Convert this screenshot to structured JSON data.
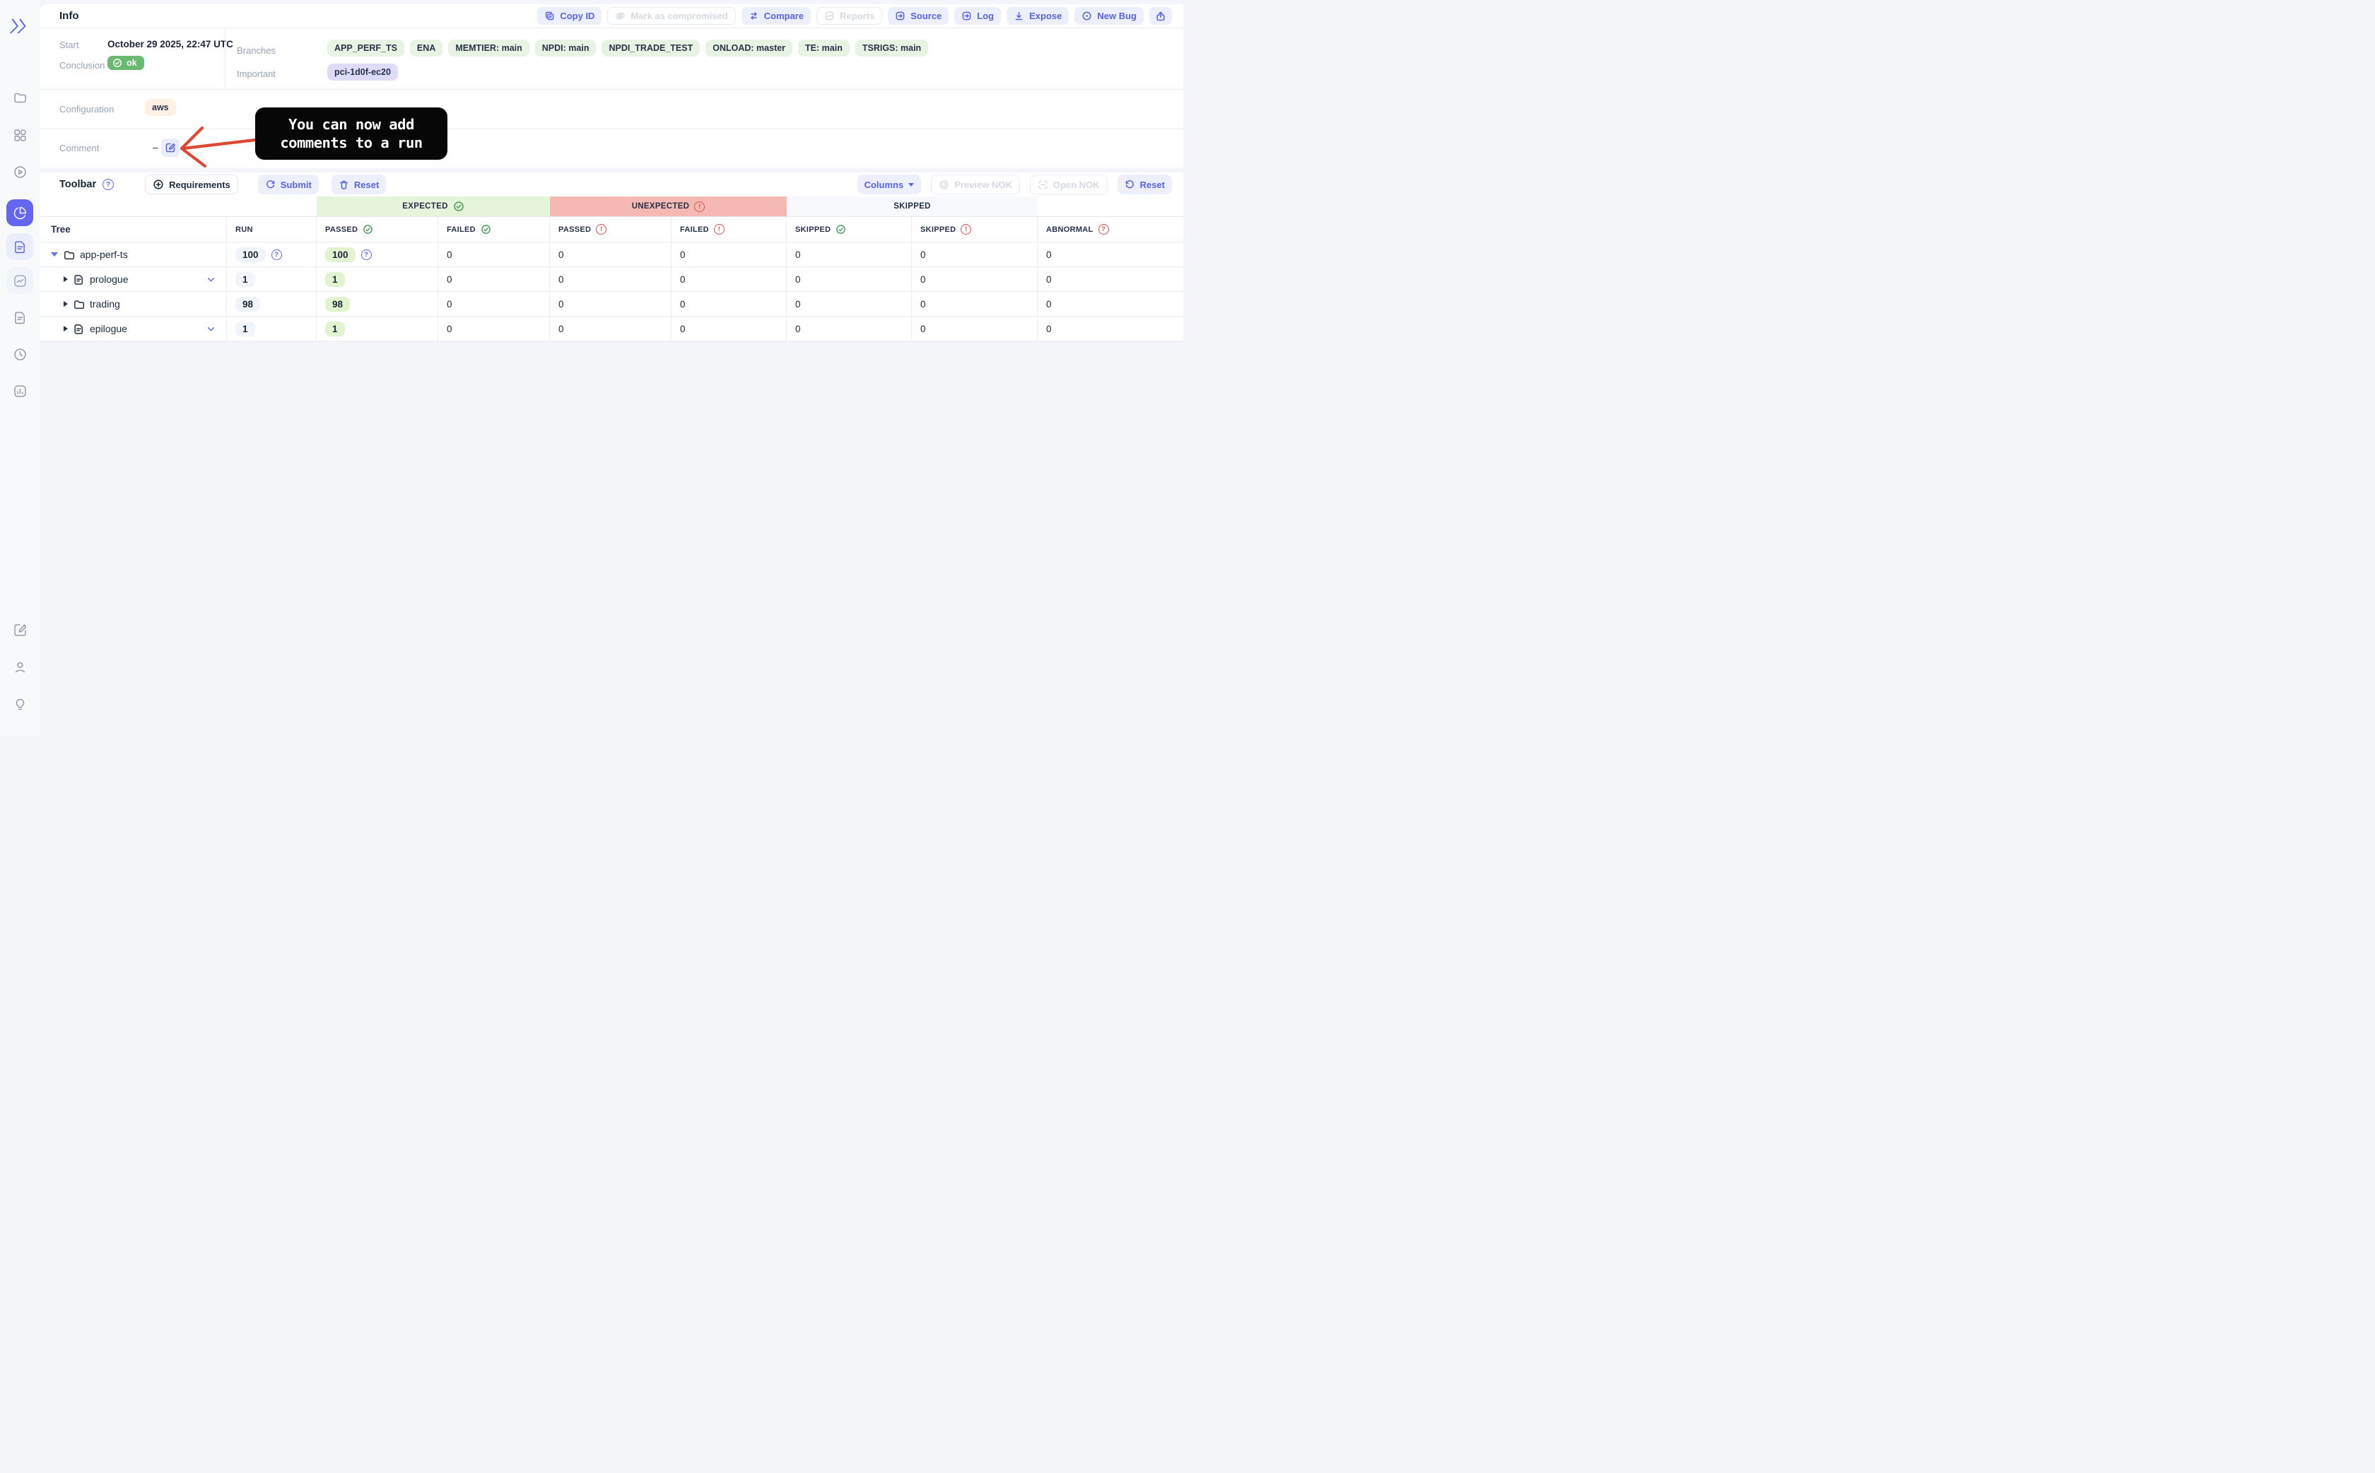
{
  "header": {
    "title": "Info",
    "actions": [
      {
        "label": "Copy ID",
        "disabled": false,
        "icon": "copy-icon"
      },
      {
        "label": "Mark as compromised",
        "disabled": true,
        "icon": "eye-off-icon"
      },
      {
        "label": "Compare",
        "disabled": false,
        "icon": "compare-arrows-icon"
      },
      {
        "label": "Reports",
        "disabled": true,
        "icon": "report-chart-icon"
      },
      {
        "label": "Source",
        "disabled": false,
        "icon": "arrow-box-icon"
      },
      {
        "label": "Log",
        "disabled": false,
        "icon": "arrow-box-icon"
      },
      {
        "label": "Expose",
        "disabled": false,
        "icon": "download-icon"
      },
      {
        "label": "New Bug",
        "disabled": false,
        "icon": "circle-dot-icon"
      }
    ],
    "share_icon": "share-icon"
  },
  "info": {
    "start_label": "Start",
    "start_value": "October 29 2025, 22:47 UTC",
    "conclusion_label": "Conclusion",
    "conclusion_value": "ok",
    "branches_label": "Branches",
    "branches": [
      "APP_PERF_TS",
      "ENA",
      "MEMTIER: main",
      "NPDI: main",
      "NPDI_TRADE_TEST",
      "ONLOAD: master",
      "TE: main",
      "TSRIGS: main"
    ],
    "important_label": "Important",
    "important_value": "pci-1d0f-ec20",
    "configuration_label": "Configuration",
    "configuration_value": "aws",
    "comment_label": "Comment",
    "comment_value": "–"
  },
  "annotation": {
    "line1": "You can now add",
    "line2": "comments to a run",
    "arrow_color": "#dd4733"
  },
  "toolbar": {
    "title": "Toolbar",
    "requirements_label": "Requirements",
    "submit_label": "Submit",
    "reset_label": "Reset",
    "columns_label": "Columns",
    "preview_nok_label": "Preview NOK",
    "open_nok_label": "Open NOK",
    "reset_right_label": "Reset"
  },
  "table": {
    "tree_header": "Tree",
    "groups": {
      "expected": "EXPECTED",
      "unexpected": "UNEXPECTED",
      "skipped": "SKIPPED"
    },
    "col_headers": {
      "run": "RUN",
      "passed_expected": "PASSED",
      "failed_expected": "FAILED",
      "passed_unexpected": "PASSED",
      "failed_unexpected": "FAILED",
      "skipped_expected": "SKIPPED",
      "skipped_unexpected": "SKIPPED",
      "abnormal": "ABNORMAL"
    },
    "rows": [
      {
        "name": "app-perf-ts",
        "type": "folder",
        "values": [
          "100",
          "100",
          "0",
          "0",
          "0",
          "0",
          "0",
          "0"
        ]
      },
      {
        "name": "prologue",
        "type": "file",
        "values": [
          "1",
          "1",
          "0",
          "0",
          "0",
          "0",
          "0",
          "0"
        ]
      },
      {
        "name": "trading",
        "type": "folder",
        "values": [
          "98",
          "98",
          "0",
          "0",
          "0",
          "0",
          "0",
          "0"
        ]
      },
      {
        "name": "epilogue",
        "type": "file",
        "values": [
          "1",
          "1",
          "0",
          "0",
          "0",
          "0",
          "0",
          "0"
        ]
      }
    ]
  },
  "sidebar": {
    "logo_icon": "double-chevron-logo",
    "top_icons": [
      "folder-icon",
      "dashboard-grid-icon",
      "play-circle-icon",
      "pie-chart-icon",
      "document-icon",
      "trend-chart-icon",
      "document-icon",
      "clock-icon",
      "bar-chart-icon"
    ],
    "bottom_icons": [
      "edit-icon",
      "user-icon",
      "lightbulb-icon"
    ],
    "active_item": "pie-chart"
  },
  "colors": {
    "accent": "#5b68e8",
    "ok_green": "#67ba70",
    "expected_bg": "#e4f5d9",
    "unexpected_bg": "#f5b8b2",
    "skipped_bg": "#f7f9fc",
    "annotation_arrow": "#dd4733"
  }
}
